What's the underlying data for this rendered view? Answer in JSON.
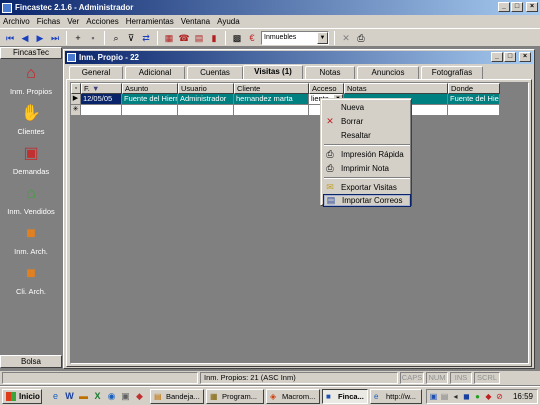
{
  "window": {
    "title": "Fincastec 2.1.6 - Administrador"
  },
  "menu": [
    "Archivo",
    "Fichas",
    "Ver",
    "Acciones",
    "Herramientas",
    "Ventana",
    "Ayuda"
  ],
  "toolbar": {
    "combo_value": "Inmuebles"
  },
  "sidebar": {
    "header": "FincasTec",
    "items": [
      {
        "label": "Inm. Propios",
        "icon": "house-icon",
        "color": "#d02020"
      },
      {
        "label": "Clientes",
        "icon": "handshake-icon",
        "color": "#f0b080"
      },
      {
        "label": "Demandas",
        "icon": "doc-house-icon",
        "color": "#c03030"
      },
      {
        "label": "Inm. Vendidos",
        "icon": "house-green-icon",
        "color": "#40a040"
      },
      {
        "label": "Inm. Arch.",
        "icon": "box-icon",
        "color": "#e08020"
      },
      {
        "label": "Cli. Arch.",
        "icon": "box-hand-icon",
        "color": "#e08020"
      }
    ],
    "footer": "Bolsa"
  },
  "child": {
    "title": "Inm. Propio - 22"
  },
  "tabs": [
    "General",
    "Adicional",
    "Cuentas",
    "Visitas (1)",
    "Notas",
    "Anuncios",
    "Fotografías"
  ],
  "active_tab": 3,
  "grid": {
    "columns": [
      "F.",
      "Asunto",
      "Usuario",
      "Cliente",
      "Acceso",
      "Notas",
      "Donde"
    ],
    "rows": [
      [
        "12/05/05",
        "Fuente del Hierr",
        "Administrador",
        "hernandez marta",
        "liente",
        "",
        "Fuente del Hie"
      ]
    ]
  },
  "context_menu": [
    "Nueva",
    "Borrar",
    "Resaltar",
    "Impresión Rápida",
    "Imprimir Nota",
    "Exportar Visitas",
    "Importar Correos"
  ],
  "status": {
    "main": "Inm. Propios: 21  (ASC Inm)",
    "indicators": [
      "CAPS",
      "NUM",
      "INS",
      "SCRL"
    ]
  },
  "taskbar": {
    "start": "Inicio",
    "tasks": [
      "Bandeja...",
      "Program...",
      "Macrom...",
      "Finca...",
      "http://w..."
    ],
    "clock": "16:59"
  },
  "colors": {
    "titlebar_start": "#0a246a",
    "titlebar_end": "#a6caf0",
    "selection_teal": "#008080",
    "face": "#d4d0c8"
  }
}
